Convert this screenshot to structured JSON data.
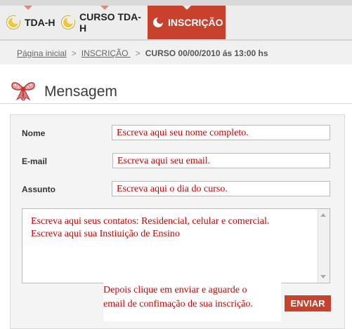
{
  "tabs": [
    {
      "label": "TDA-H",
      "icon": "crescent-icon",
      "active": false
    },
    {
      "label": "CURSO TDA-H",
      "icon": "crescent-icon",
      "active": false
    },
    {
      "label": "INSCRIÇÃO",
      "icon": "crescent-icon",
      "active": true
    }
  ],
  "breadcrumb": {
    "home": "Página inicial",
    "sep1": ">",
    "section": "INSCRIÇÃO ",
    "sep2": ">",
    "current": "CURSO 00/00/2010 ás 13:00 hs"
  },
  "header": {
    "title": "Mensagem",
    "icon": "bow-icon"
  },
  "form": {
    "name_label": "Nome",
    "name_value": "Escreva aqui seu nome completo.",
    "email_label": "E-mail",
    "email_value": "Escreva aqui seu email.",
    "subject_label": "Assunto",
    "subject_value": "Escreva aqui o dia do curso.",
    "message_line1": "Escreva aqui seus contatos: Residencial, celular e comercial.",
    "message_line2": "Escreva aqui sua Instiuição de Ensino",
    "note_line1": "Depois clique em enviar e aguarde o",
    "note_line2": "email de confimação de sua inscrição.",
    "submit_label": "ENVIAR"
  },
  "colors": {
    "accent": "#c8412c",
    "hint_text": "#cc0000"
  }
}
